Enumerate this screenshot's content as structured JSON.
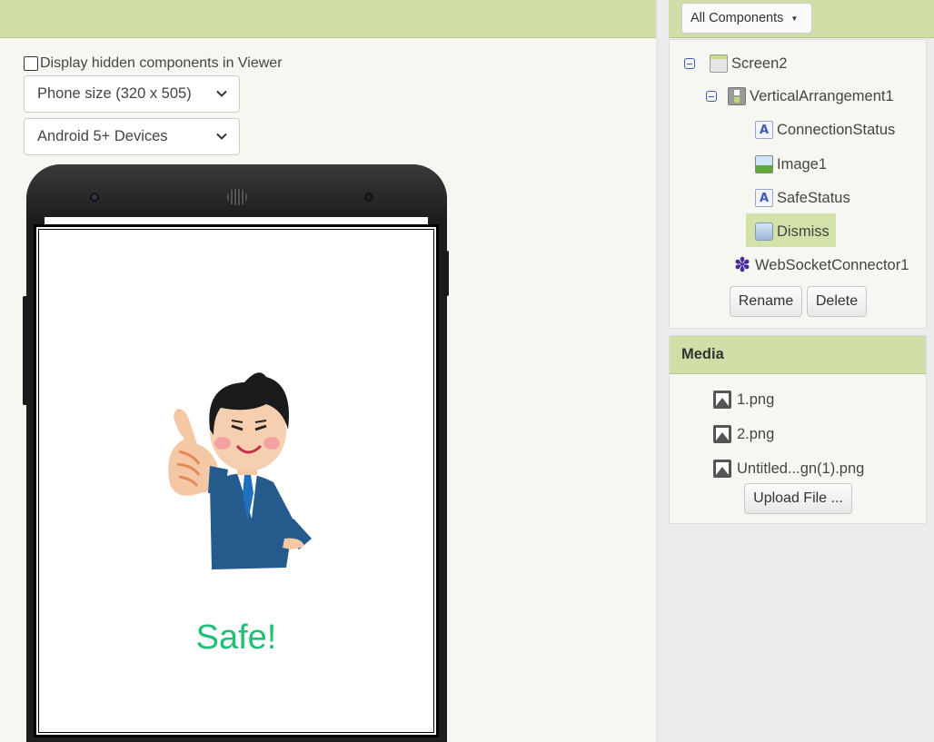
{
  "viewer": {
    "show_hidden_label": "Display hidden components in Viewer",
    "size_select": "Phone size (320 x 505)",
    "device_select": "Android 5+ Devices",
    "screen_text": "Safe!",
    "screen_text_color": "#1fbf75"
  },
  "components": {
    "filter_button": "All Components",
    "tree": [
      {
        "label": "Screen2",
        "icon": "screen-icon"
      },
      {
        "label": "VerticalArrangement1",
        "icon": "vertical-arrangement-icon"
      },
      {
        "label": "ConnectionStatus",
        "icon": "label-icon"
      },
      {
        "label": "Image1",
        "icon": "image-icon"
      },
      {
        "label": "SafeStatus",
        "icon": "label-icon"
      },
      {
        "label": "Dismiss",
        "icon": "button-icon",
        "selected": true
      },
      {
        "label": "WebSocketConnector1",
        "icon": "extension-puzzle-icon"
      }
    ],
    "rename_button": "Rename",
    "delete_button": "Delete"
  },
  "media": {
    "title": "Media",
    "files": [
      "1.png",
      "2.png",
      "Untitled...gn(1).png"
    ],
    "upload_button": "Upload File ..."
  },
  "colors": {
    "header_green": "#cfdfa7",
    "selection_green": "#d3e2a9"
  }
}
